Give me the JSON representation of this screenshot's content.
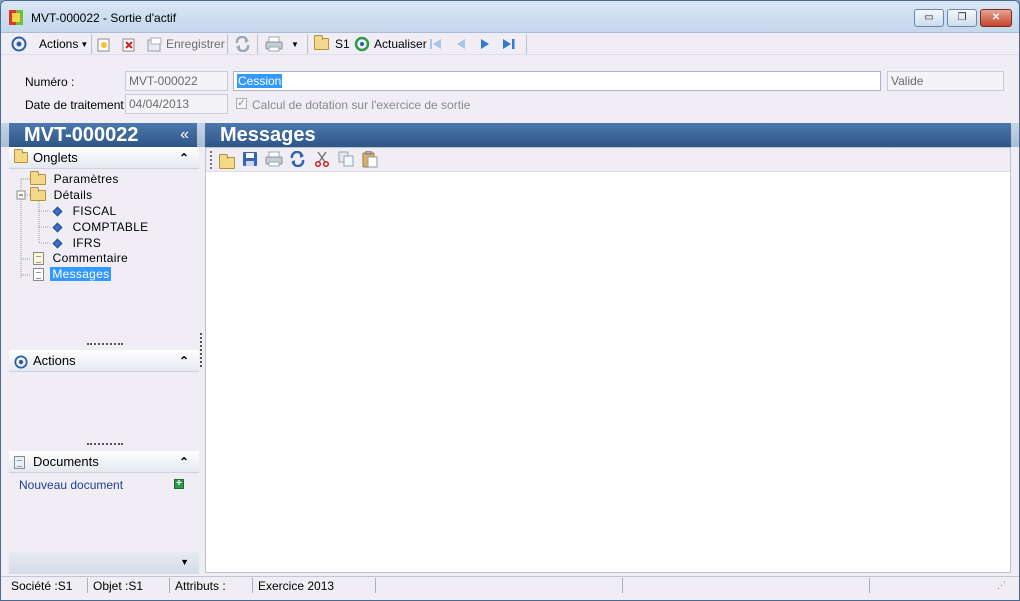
{
  "window": {
    "title": "MVT-000022 -  Sortie d'actif",
    "controls": {
      "minimize": "▭",
      "restore": "❐",
      "close": "✕"
    }
  },
  "toolbar": {
    "actions_label": "Actions",
    "save_label": "Enregistrer",
    "s1_label": "S1",
    "refresh_label": "Actualiser"
  },
  "form": {
    "numero_label": "Numéro :",
    "numero_value": "MVT-000022",
    "libelle_value": "Cession",
    "status_value": "Valide",
    "date_label": "Date de traitement :",
    "date_value": "04/04/2013",
    "calcul_label": "Calcul de dotation sur l'exercice de sortie",
    "calcul_checked": true
  },
  "nav": {
    "title": "MVT-000022",
    "collapse_glyph": "«",
    "onglets_header": "Onglets",
    "tree": [
      {
        "label": "Paramètres",
        "kind": "folder"
      },
      {
        "label": "Détails",
        "kind": "folder"
      },
      {
        "label": "FISCAL",
        "kind": "leaf"
      },
      {
        "label": "COMPTABLE",
        "kind": "leaf"
      },
      {
        "label": "IFRS",
        "kind": "leaf"
      },
      {
        "label": "Commentaire",
        "kind": "doc"
      },
      {
        "label": "Messages",
        "kind": "doc",
        "selected": true
      }
    ],
    "actions_header": "Actions",
    "documents_header": "Documents",
    "new_document_label": "Nouveau document"
  },
  "main": {
    "title": "Messages"
  },
  "statusbar": {
    "societe": "Société :S1",
    "objet": "Objet :S1",
    "attributs": "Attributs :",
    "exercice": "Exercice 2013"
  },
  "colors": {
    "header_blue": "#2e5588",
    "selection": "#3399ff",
    "link_blue": "#1c3f94"
  }
}
